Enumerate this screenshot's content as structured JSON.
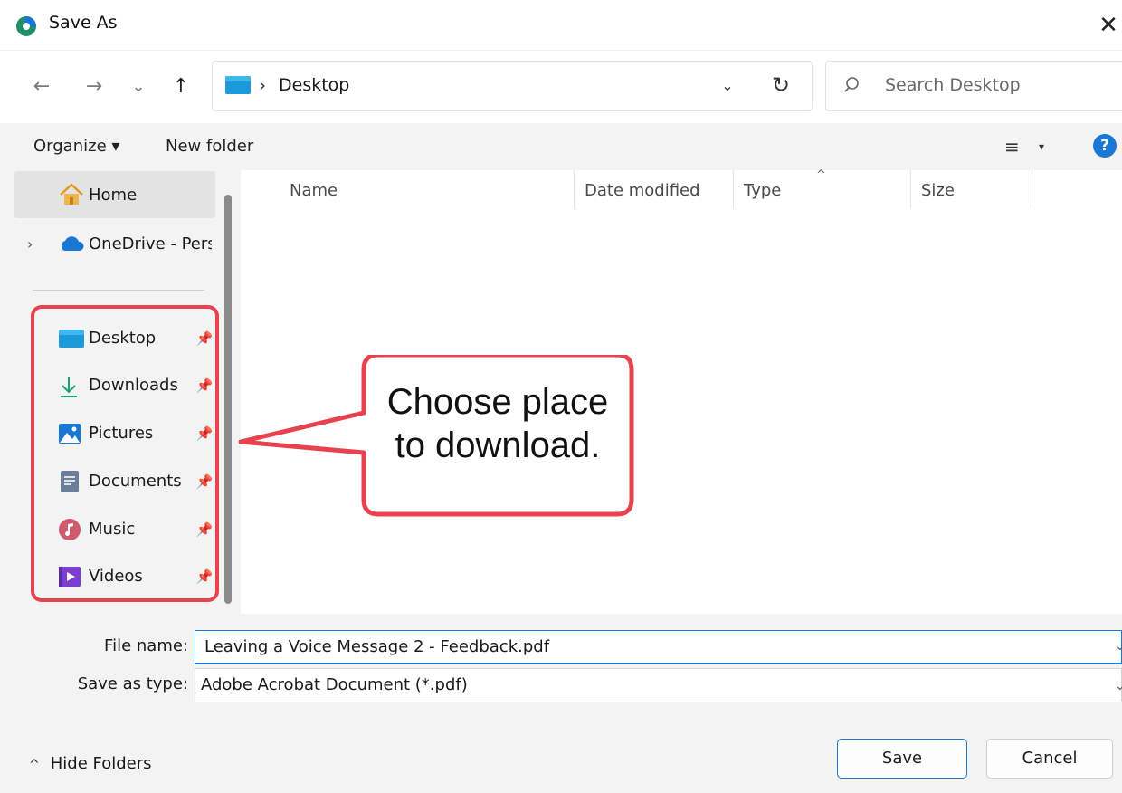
{
  "window": {
    "title": "Save As",
    "close_glyph": "✕"
  },
  "nav": {
    "back_glyph": "←",
    "forward_glyph": "→",
    "recent_glyph": "⌄",
    "up_glyph": "↑",
    "address": {
      "separator": "›",
      "location": "Desktop",
      "dropdown_glyph": "⌄",
      "refresh_glyph": "↻"
    },
    "search": {
      "placeholder": "Search Desktop"
    }
  },
  "commands": {
    "organize": "Organize ▾",
    "new_folder": "New folder",
    "view_glyph": "≡",
    "view_dropdown_glyph": "▾",
    "help_glyph": "?"
  },
  "sidebar": {
    "home": "Home",
    "onedrive": "OneDrive - Perso",
    "tree_chevron": "›",
    "pin_glyph": "📌",
    "quick_access": [
      {
        "label": "Desktop",
        "icon": "desktop-icon",
        "color": "#1a9ad9"
      },
      {
        "label": "Downloads",
        "icon": "download-icon",
        "color": "#1aa26c"
      },
      {
        "label": "Pictures",
        "icon": "pictures-icon",
        "color": "#1a78d4"
      },
      {
        "label": "Documents",
        "icon": "documents-icon",
        "color": "#6a7d99"
      },
      {
        "label": "Music",
        "icon": "music-icon",
        "color": "#e0653a"
      },
      {
        "label": "Videos",
        "icon": "videos-icon",
        "color": "#7a3fd1"
      }
    ]
  },
  "columns": {
    "name": "Name",
    "date_modified": "Date modified",
    "type": "Type",
    "size": "Size",
    "sort_caret": "^"
  },
  "callout": {
    "line1": "Choose place",
    "line2": "to download.",
    "color": "#e8424f"
  },
  "form": {
    "file_name_label": "File name:",
    "file_name_value": "Leaving a Voice Message 2 - Feedback.pdf",
    "save_type_label": "Save as type:",
    "save_type_value": "Adobe Acrobat Document (*.pdf)",
    "dropdown_glyph": "⌄"
  },
  "footer": {
    "hide_folders": "Hide Folders",
    "hide_folders_glyph": "^",
    "save": "Save",
    "cancel": "Cancel"
  },
  "colors": {
    "accent": "#1a78d4",
    "pane_bg": "#f3f3f3",
    "selected_bg": "#e3e3e3"
  }
}
